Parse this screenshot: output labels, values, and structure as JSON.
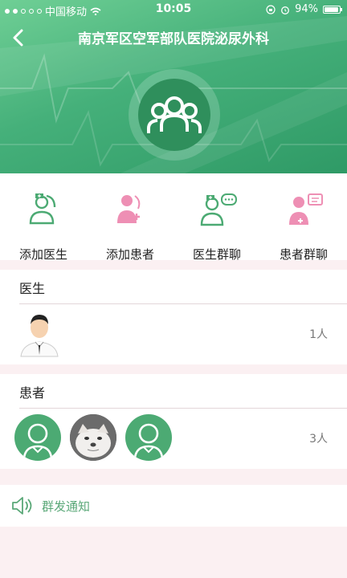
{
  "status_bar": {
    "carrier": "中国移动",
    "time": "10:05",
    "battery": "94%",
    "battery_level": 0.94
  },
  "nav": {
    "title": "南京军区空军部队医院泌尿外科",
    "back_icon": "chevron-left-icon"
  },
  "header": {
    "avatar_icon": "group-icon",
    "accent": "#45b07a"
  },
  "actions": [
    {
      "label": "添加医生",
      "icon": "doctor-add-icon",
      "color": "#4caa73"
    },
    {
      "label": "添加患者",
      "icon": "patient-add-icon",
      "color": "#ee8fb4"
    },
    {
      "label": "医生群聊",
      "icon": "doctor-chat-icon",
      "color": "#4caa73"
    },
    {
      "label": "患者群聊",
      "icon": "patient-chat-icon",
      "color": "#ee8fb4"
    }
  ],
  "doctors": {
    "title": "医生",
    "count": "1人",
    "members": [
      {
        "icon": "doctor-avatar-icon"
      }
    ]
  },
  "patients": {
    "title": "患者",
    "count": "3人",
    "members": [
      {
        "icon": "default-avatar-icon"
      },
      {
        "icon": "cat-photo-avatar"
      },
      {
        "icon": "default-avatar-icon"
      }
    ]
  },
  "broadcast": {
    "label": "群发通知",
    "icon": "speaker-icon"
  }
}
